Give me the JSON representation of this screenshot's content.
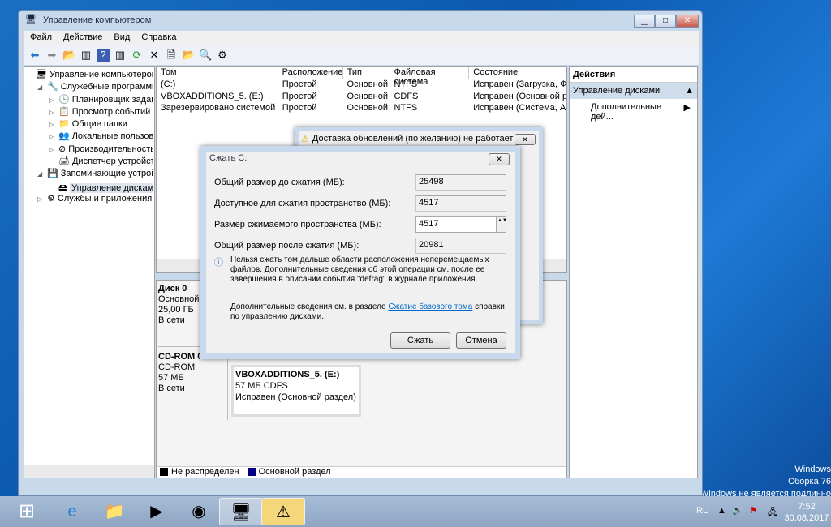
{
  "window": {
    "title": "Управление компьютером",
    "min": "▁",
    "max": "□",
    "close": "✕"
  },
  "menu": [
    "Файл",
    "Действие",
    "Вид",
    "Справка"
  ],
  "tree": [
    {
      "label": "Управление компьютером (л",
      "indent": 0,
      "arrow": "",
      "icon": "🖥"
    },
    {
      "label": "Служебные программы",
      "indent": 1,
      "arrow": "◢",
      "icon": "🔧"
    },
    {
      "label": "Планировщик заданий",
      "indent": 2,
      "arrow": "▷",
      "icon": "🕒"
    },
    {
      "label": "Просмотр событий",
      "indent": 2,
      "arrow": "▷",
      "icon": "📋"
    },
    {
      "label": "Общие папки",
      "indent": 2,
      "arrow": "▷",
      "icon": "📁"
    },
    {
      "label": "Локальные пользовате",
      "indent": 2,
      "arrow": "▷",
      "icon": "👥"
    },
    {
      "label": "Производительность",
      "indent": 2,
      "arrow": "▷",
      "icon": "⊘"
    },
    {
      "label": "Диспетчер устройств",
      "indent": 2,
      "arrow": "",
      "icon": "🖨"
    },
    {
      "label": "Запоминающие устройст",
      "indent": 1,
      "arrow": "◢",
      "icon": "💾"
    },
    {
      "label": "Управление дисками",
      "indent": 2,
      "arrow": "",
      "icon": "🖴",
      "selected": true
    },
    {
      "label": "Службы и приложения",
      "indent": 1,
      "arrow": "▷",
      "icon": "⚙"
    }
  ],
  "volumes": {
    "headers": [
      "Том",
      "Расположение",
      "Тип",
      "Файловая система",
      "Состояние"
    ],
    "rows": [
      [
        "(C:)",
        "Простой",
        "Основной",
        "NTFS",
        "Исправен (Загрузка, Фай"
      ],
      [
        "VBOXADDITIONS_5. (E:)",
        "Простой",
        "Основной",
        "CDFS",
        "Исправен (Основной раз"
      ],
      [
        "Зарезервировано системой",
        "Простой",
        "Основной",
        "NTFS",
        "Исправен (Система, Акти"
      ]
    ]
  },
  "disks": [
    {
      "name": "Диск 0",
      "type": "Основной",
      "size": "25,00 ГБ",
      "status": "В сети"
    },
    {
      "name": "CD-ROM 0",
      "type": "CD-ROM",
      "size": "57 МБ",
      "status": "В сети",
      "partition": {
        "name": "VBOXADDITIONS_5.  (E:)",
        "size": "57 МБ CDFS",
        "status": "Исправен (Основной раздел)"
      }
    }
  ],
  "legend": [
    {
      "label": "Не распределен",
      "color": "#000000"
    },
    {
      "label": "Основной раздел",
      "color": "#000080"
    }
  ],
  "actions": {
    "title": "Действия",
    "section": "Управление дисками",
    "item": "Дополнительные дей..."
  },
  "bg_dialog": {
    "title": "Доставка обновлений (по желанию) не работает"
  },
  "shrink": {
    "title": "Сжать C:",
    "fields": [
      {
        "label": "Общий размер до сжатия (МБ):",
        "value": "25498"
      },
      {
        "label": "Доступное для сжатия пространство (МБ):",
        "value": "4517"
      },
      {
        "label": "Размер сжимаемого пространства (МБ):",
        "value": "4517"
      },
      {
        "label": "Общий размер после сжатия (МБ):",
        "value": "20981"
      }
    ],
    "info": "Нельзя сжать том дальше области расположения неперемещаемых файлов. Дополнительные сведения об этой операции см. после ее завершения в описании события \"defrag\" в журнале приложения.",
    "more_before": "Дополнительные сведения см. в разделе ",
    "more_link": "Сжатие базового тома",
    "more_after": " справки по управлению дисками.",
    "ok": "Сжать",
    "cancel": "Отмена"
  },
  "desktop": {
    "line1": "Windows",
    "line2": "Сборка 76",
    "line3": "ия Windows не является подлинно"
  },
  "tray": {
    "lang": "RU",
    "time": "7:52",
    "date": "30.08.2017"
  }
}
